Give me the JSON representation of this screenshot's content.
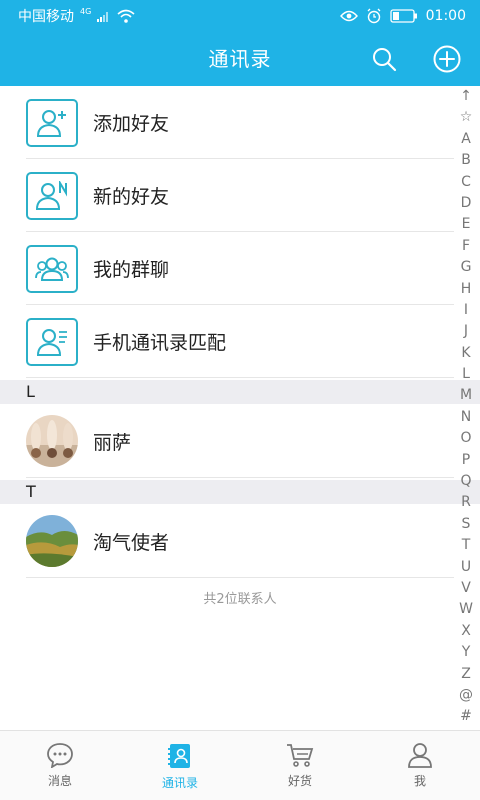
{
  "status_bar": {
    "carrier": "中国移动",
    "network": "4G",
    "time": "01:00"
  },
  "header": {
    "title": "通讯录",
    "search_icon": "search-icon",
    "add_icon": "plus-circle-icon"
  },
  "functions": [
    {
      "label": "添加好友",
      "icon": "add-friend-icon"
    },
    {
      "label": "新的好友",
      "icon": "new-friend-icon"
    },
    {
      "label": "我的群聊",
      "icon": "group-chat-icon"
    },
    {
      "label": "手机通讯录匹配",
      "icon": "phone-contacts-icon"
    }
  ],
  "sections": [
    {
      "letter": "L",
      "contacts": [
        {
          "name": "丽萨"
        }
      ]
    },
    {
      "letter": "T",
      "contacts": [
        {
          "name": "淘气使者"
        }
      ]
    }
  ],
  "contact_count": "共2位联系人",
  "alphabet_index": [
    "↑",
    "☆",
    "A",
    "B",
    "C",
    "D",
    "E",
    "F",
    "G",
    "H",
    "I",
    "J",
    "K",
    "L",
    "M",
    "N",
    "O",
    "P",
    "Q",
    "R",
    "S",
    "T",
    "U",
    "V",
    "W",
    "X",
    "Y",
    "Z",
    "@",
    "#"
  ],
  "tabs": [
    {
      "label": "消息",
      "icon": "message-icon",
      "active": false
    },
    {
      "label": "通讯录",
      "icon": "contacts-icon",
      "active": true
    },
    {
      "label": "好货",
      "icon": "cart-icon",
      "active": false
    },
    {
      "label": "我",
      "icon": "person-icon",
      "active": false
    }
  ],
  "colors": {
    "accent": "#1fb3e6",
    "icon_teal": "#2bb0c8",
    "section_bg": "#ededf1"
  }
}
